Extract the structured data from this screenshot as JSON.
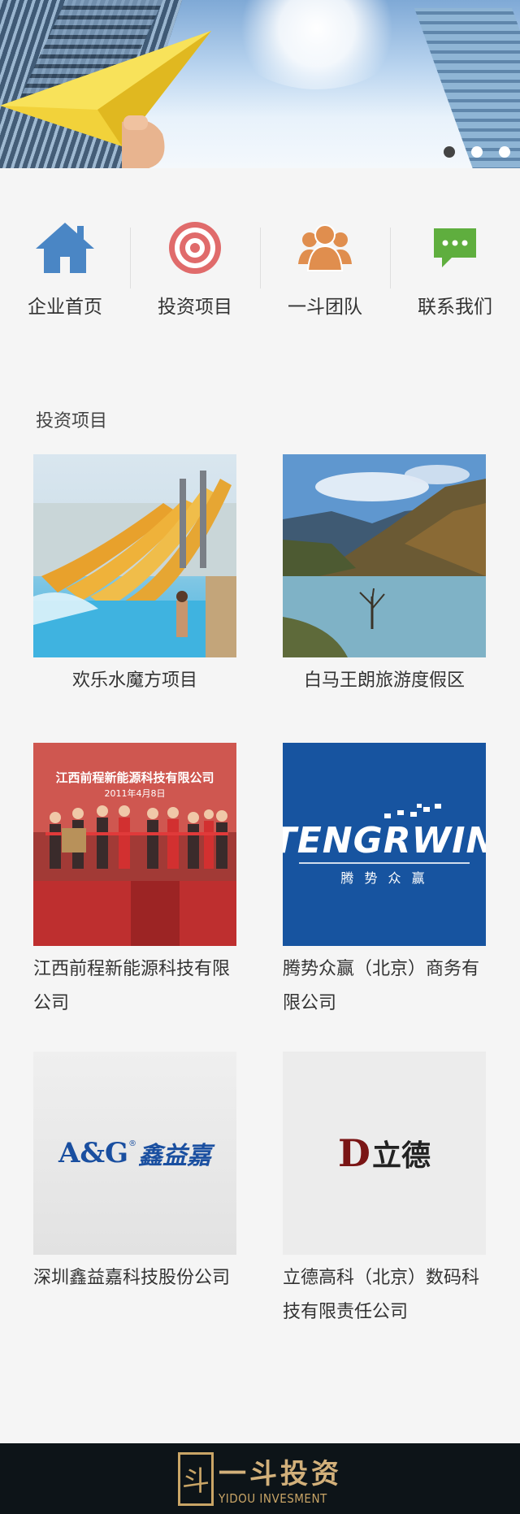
{
  "banner": {
    "slide_count": 3,
    "active_slide": 1
  },
  "nav": [
    {
      "label": "企业首页",
      "icon": "home-icon",
      "color": "#4a86c5"
    },
    {
      "label": "投资项目",
      "icon": "target-icon",
      "color": "#e06b6b"
    },
    {
      "label": "一斗团队",
      "icon": "team-icon",
      "color": "#e08e4e"
    },
    {
      "label": "联系我们",
      "icon": "chat-icon",
      "color": "#5fae3e"
    }
  ],
  "section": {
    "title": "投资项目",
    "projects": [
      {
        "name": "欢乐水魔方项目",
        "image": "water-park"
      },
      {
        "name": "白马王朗旅游度假区",
        "image": "mountain-lake"
      },
      {
        "name": "江西前程新能源科技有限公司",
        "image": "ribbon-ceremony",
        "banner_text": "江西前程新能源科技有限公司",
        "banner_date": "2011年4月8日"
      },
      {
        "name": "腾势众赢（北京）商务有限公司",
        "image": "tengerwin-logo",
        "logo_text": "TENGRWIN",
        "logo_sub": "腾 势 众 赢"
      },
      {
        "name": "深圳鑫益嘉科技股份公司",
        "image": "ag-logo",
        "logo_text": "A&G",
        "logo_cn": "鑫益嘉"
      },
      {
        "name": "立德高科（北京）数码科技有限责任公司",
        "image": "lide-logo",
        "logo_text": "立德"
      }
    ]
  },
  "footer": {
    "logo_mark": "斗",
    "logo_cn": "一斗投资",
    "logo_en": "YIDOU INVESMENT"
  }
}
